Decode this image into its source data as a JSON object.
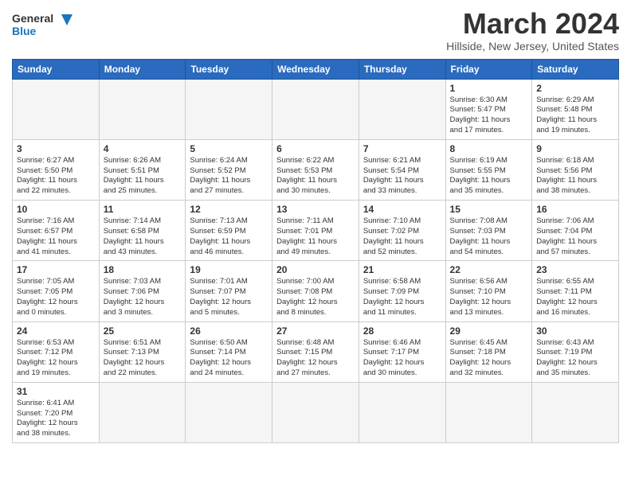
{
  "header": {
    "logo_general": "General",
    "logo_blue": "Blue",
    "month_title": "March 2024",
    "location": "Hillside, New Jersey, United States"
  },
  "weekdays": [
    "Sunday",
    "Monday",
    "Tuesday",
    "Wednesday",
    "Thursday",
    "Friday",
    "Saturday"
  ],
  "weeks": [
    [
      {
        "day": "",
        "info": ""
      },
      {
        "day": "",
        "info": ""
      },
      {
        "day": "",
        "info": ""
      },
      {
        "day": "",
        "info": ""
      },
      {
        "day": "",
        "info": ""
      },
      {
        "day": "1",
        "info": "Sunrise: 6:30 AM\nSunset: 5:47 PM\nDaylight: 11 hours\nand 17 minutes."
      },
      {
        "day": "2",
        "info": "Sunrise: 6:29 AM\nSunset: 5:48 PM\nDaylight: 11 hours\nand 19 minutes."
      }
    ],
    [
      {
        "day": "3",
        "info": "Sunrise: 6:27 AM\nSunset: 5:50 PM\nDaylight: 11 hours\nand 22 minutes."
      },
      {
        "day": "4",
        "info": "Sunrise: 6:26 AM\nSunset: 5:51 PM\nDaylight: 11 hours\nand 25 minutes."
      },
      {
        "day": "5",
        "info": "Sunrise: 6:24 AM\nSunset: 5:52 PM\nDaylight: 11 hours\nand 27 minutes."
      },
      {
        "day": "6",
        "info": "Sunrise: 6:22 AM\nSunset: 5:53 PM\nDaylight: 11 hours\nand 30 minutes."
      },
      {
        "day": "7",
        "info": "Sunrise: 6:21 AM\nSunset: 5:54 PM\nDaylight: 11 hours\nand 33 minutes."
      },
      {
        "day": "8",
        "info": "Sunrise: 6:19 AM\nSunset: 5:55 PM\nDaylight: 11 hours\nand 35 minutes."
      },
      {
        "day": "9",
        "info": "Sunrise: 6:18 AM\nSunset: 5:56 PM\nDaylight: 11 hours\nand 38 minutes."
      }
    ],
    [
      {
        "day": "10",
        "info": "Sunrise: 7:16 AM\nSunset: 6:57 PM\nDaylight: 11 hours\nand 41 minutes."
      },
      {
        "day": "11",
        "info": "Sunrise: 7:14 AM\nSunset: 6:58 PM\nDaylight: 11 hours\nand 43 minutes."
      },
      {
        "day": "12",
        "info": "Sunrise: 7:13 AM\nSunset: 6:59 PM\nDaylight: 11 hours\nand 46 minutes."
      },
      {
        "day": "13",
        "info": "Sunrise: 7:11 AM\nSunset: 7:01 PM\nDaylight: 11 hours\nand 49 minutes."
      },
      {
        "day": "14",
        "info": "Sunrise: 7:10 AM\nSunset: 7:02 PM\nDaylight: 11 hours\nand 52 minutes."
      },
      {
        "day": "15",
        "info": "Sunrise: 7:08 AM\nSunset: 7:03 PM\nDaylight: 11 hours\nand 54 minutes."
      },
      {
        "day": "16",
        "info": "Sunrise: 7:06 AM\nSunset: 7:04 PM\nDaylight: 11 hours\nand 57 minutes."
      }
    ],
    [
      {
        "day": "17",
        "info": "Sunrise: 7:05 AM\nSunset: 7:05 PM\nDaylight: 12 hours\nand 0 minutes."
      },
      {
        "day": "18",
        "info": "Sunrise: 7:03 AM\nSunset: 7:06 PM\nDaylight: 12 hours\nand 3 minutes."
      },
      {
        "day": "19",
        "info": "Sunrise: 7:01 AM\nSunset: 7:07 PM\nDaylight: 12 hours\nand 5 minutes."
      },
      {
        "day": "20",
        "info": "Sunrise: 7:00 AM\nSunset: 7:08 PM\nDaylight: 12 hours\nand 8 minutes."
      },
      {
        "day": "21",
        "info": "Sunrise: 6:58 AM\nSunset: 7:09 PM\nDaylight: 12 hours\nand 11 minutes."
      },
      {
        "day": "22",
        "info": "Sunrise: 6:56 AM\nSunset: 7:10 PM\nDaylight: 12 hours\nand 13 minutes."
      },
      {
        "day": "23",
        "info": "Sunrise: 6:55 AM\nSunset: 7:11 PM\nDaylight: 12 hours\nand 16 minutes."
      }
    ],
    [
      {
        "day": "24",
        "info": "Sunrise: 6:53 AM\nSunset: 7:12 PM\nDaylight: 12 hours\nand 19 minutes."
      },
      {
        "day": "25",
        "info": "Sunrise: 6:51 AM\nSunset: 7:13 PM\nDaylight: 12 hours\nand 22 minutes."
      },
      {
        "day": "26",
        "info": "Sunrise: 6:50 AM\nSunset: 7:14 PM\nDaylight: 12 hours\nand 24 minutes."
      },
      {
        "day": "27",
        "info": "Sunrise: 6:48 AM\nSunset: 7:15 PM\nDaylight: 12 hours\nand 27 minutes."
      },
      {
        "day": "28",
        "info": "Sunrise: 6:46 AM\nSunset: 7:17 PM\nDaylight: 12 hours\nand 30 minutes."
      },
      {
        "day": "29",
        "info": "Sunrise: 6:45 AM\nSunset: 7:18 PM\nDaylight: 12 hours\nand 32 minutes."
      },
      {
        "day": "30",
        "info": "Sunrise: 6:43 AM\nSunset: 7:19 PM\nDaylight: 12 hours\nand 35 minutes."
      }
    ],
    [
      {
        "day": "31",
        "info": "Sunrise: 6:41 AM\nSunset: 7:20 PM\nDaylight: 12 hours\nand 38 minutes."
      },
      {
        "day": "",
        "info": ""
      },
      {
        "day": "",
        "info": ""
      },
      {
        "day": "",
        "info": ""
      },
      {
        "day": "",
        "info": ""
      },
      {
        "day": "",
        "info": ""
      },
      {
        "day": "",
        "info": ""
      }
    ]
  ]
}
